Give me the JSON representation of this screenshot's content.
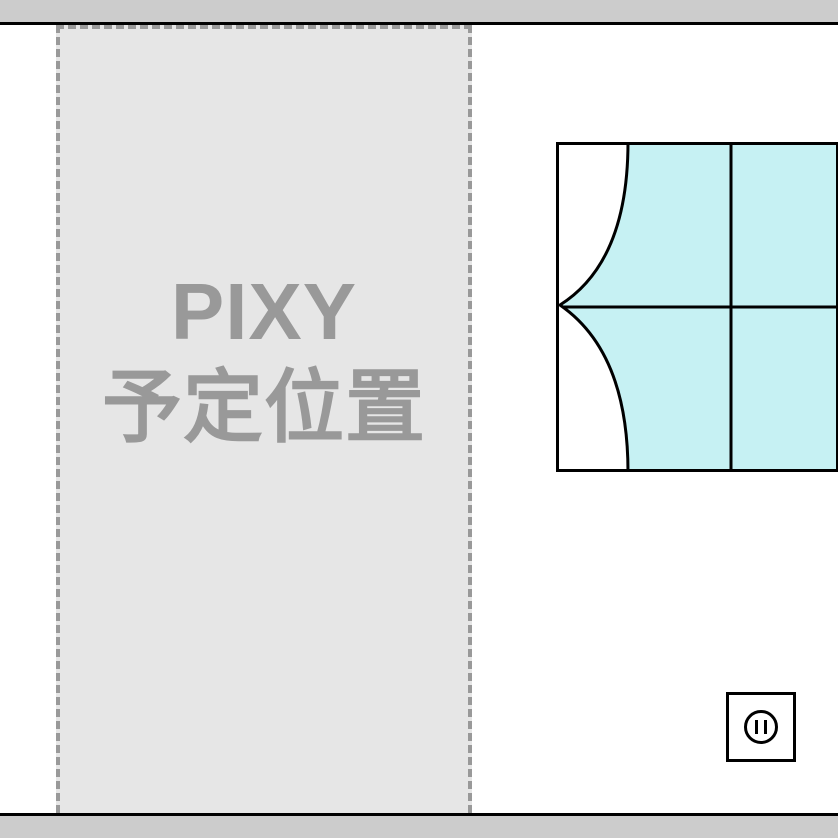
{
  "placeholder": {
    "line1": "PIXY",
    "line2": "予定位置"
  },
  "colors": {
    "window_glass": "#c6f1f3",
    "frame": "#000000",
    "placeholder_bg": "#e6e6e6",
    "placeholder_border": "#999999",
    "bar_gray": "#cccccc"
  },
  "icons": {
    "window": "window-icon",
    "curtain": "curtain-icon",
    "outlet": "power-outlet-icon"
  }
}
